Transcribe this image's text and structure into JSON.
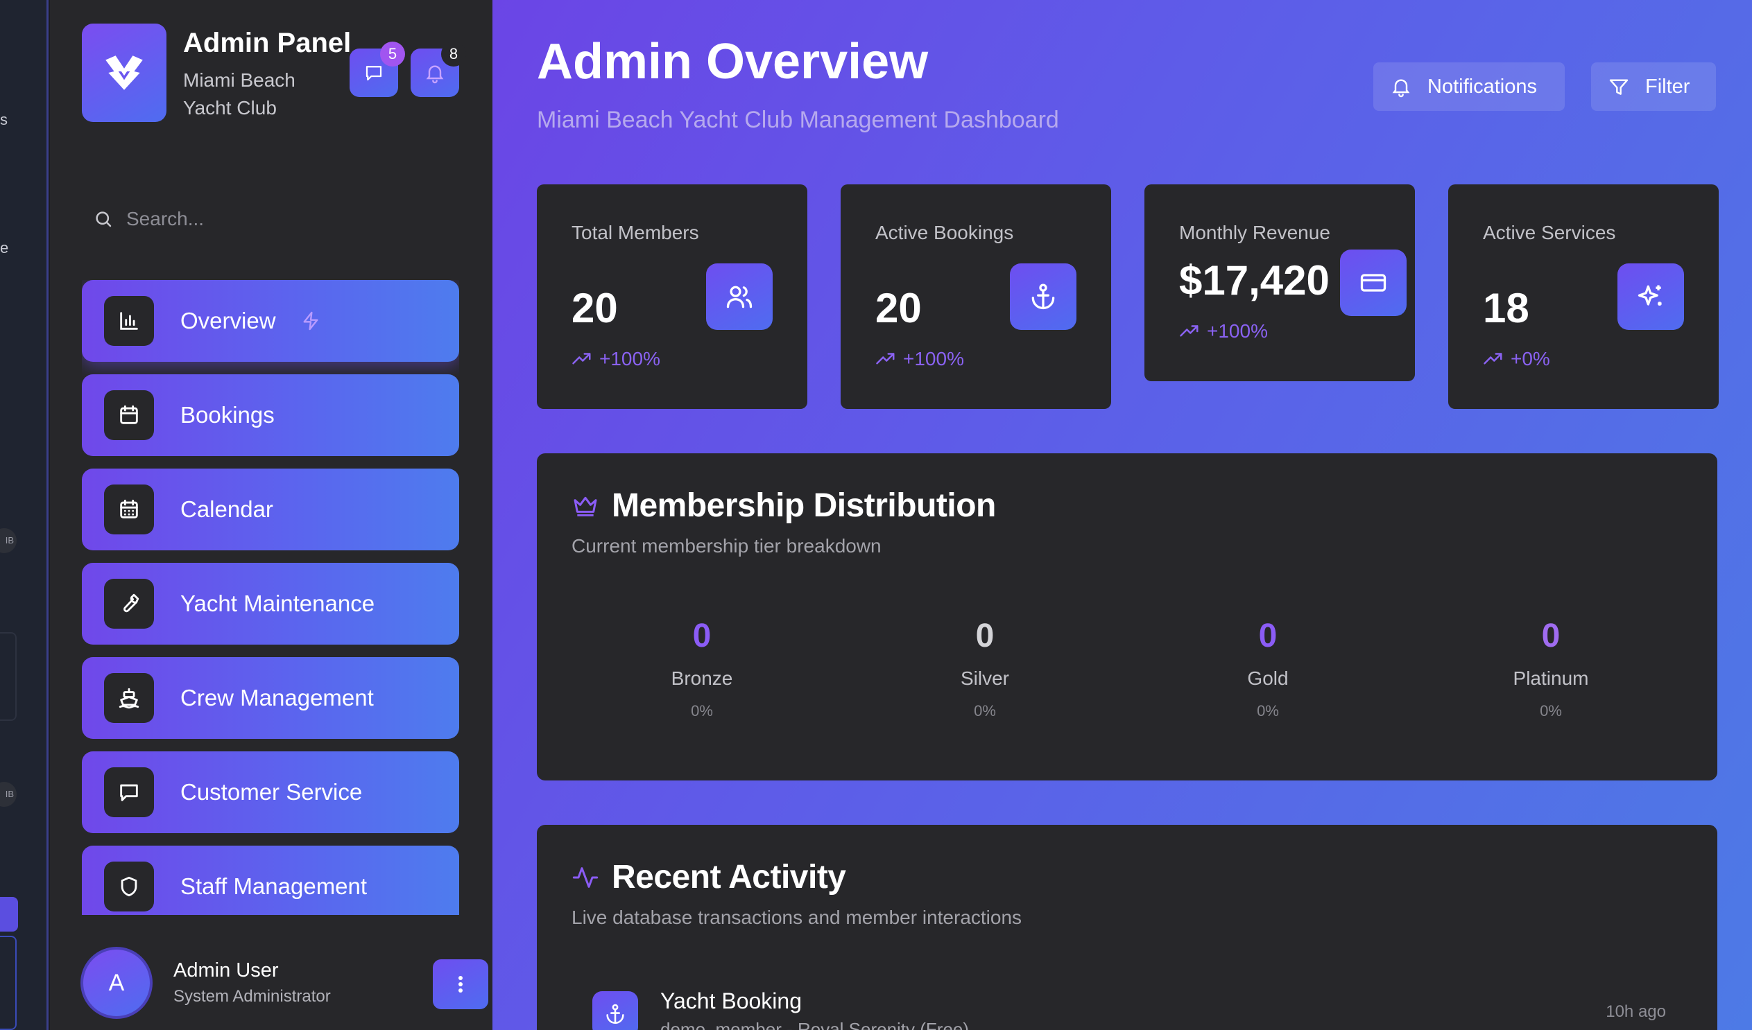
{
  "brand": {
    "title": "Admin Panel",
    "subtitle": "Miami Beach Yacht Club",
    "messages_badge": "5",
    "alerts_badge": "8"
  },
  "search": {
    "placeholder": "Search..."
  },
  "nav": [
    {
      "label": "Overview",
      "icon": "bar-chart-icon",
      "active": true
    },
    {
      "label": "Bookings",
      "icon": "calendar-icon",
      "active": false
    },
    {
      "label": "Calendar",
      "icon": "calendar-grid-icon",
      "active": false
    },
    {
      "label": "Yacht Maintenance",
      "icon": "wrench-icon",
      "active": false
    },
    {
      "label": "Crew Management",
      "icon": "ship-icon",
      "active": false
    },
    {
      "label": "Customer Service",
      "icon": "message-square-icon",
      "active": false
    },
    {
      "label": "Staff Management",
      "icon": "shield-icon",
      "active": false
    }
  ],
  "user": {
    "initial": "A",
    "name": "Admin User",
    "role": "System Administrator"
  },
  "header": {
    "title": "Admin Overview",
    "subtitle": "Miami Beach Yacht Club Management Dashboard",
    "notifications_label": "Notifications",
    "filter_label": "Filter"
  },
  "stats": [
    {
      "label": "Total Members",
      "value": "20",
      "trend": "+100%",
      "icon": "users-icon"
    },
    {
      "label": "Active Bookings",
      "value": "20",
      "trend": "+100%",
      "icon": "anchor-icon"
    },
    {
      "label": "Monthly Revenue",
      "value": "$17,420",
      "trend": "+100%",
      "icon": "credit-card-icon"
    },
    {
      "label": "Active Services",
      "value": "18",
      "trend": "+0%",
      "icon": "sparkles-icon"
    }
  ],
  "membership": {
    "title": "Membership Distribution",
    "subtitle": "Current membership tier breakdown",
    "tiers": [
      {
        "name": "Bronze",
        "count": "0",
        "percent": "0%",
        "color": "#8b5cf6"
      },
      {
        "name": "Silver",
        "count": "0",
        "percent": "0%",
        "color": "#d4d4d8"
      },
      {
        "name": "Gold",
        "count": "0",
        "percent": "0%",
        "color": "#8b5cf6"
      },
      {
        "name": "Platinum",
        "count": "0",
        "percent": "0%",
        "color": "#a06cf0"
      }
    ]
  },
  "activity": {
    "title": "Recent Activity",
    "subtitle": "Live database transactions and member interactions",
    "items": [
      {
        "title": "Yacht Booking",
        "description": "demo_member - Royal Serenity (Free)",
        "time": "10h ago",
        "icon": "anchor-icon"
      }
    ]
  },
  "colors": {
    "accent": "#7048ea",
    "accent_end": "#4e7cee",
    "panel": "#27272a",
    "trend": "#8a62f2"
  }
}
